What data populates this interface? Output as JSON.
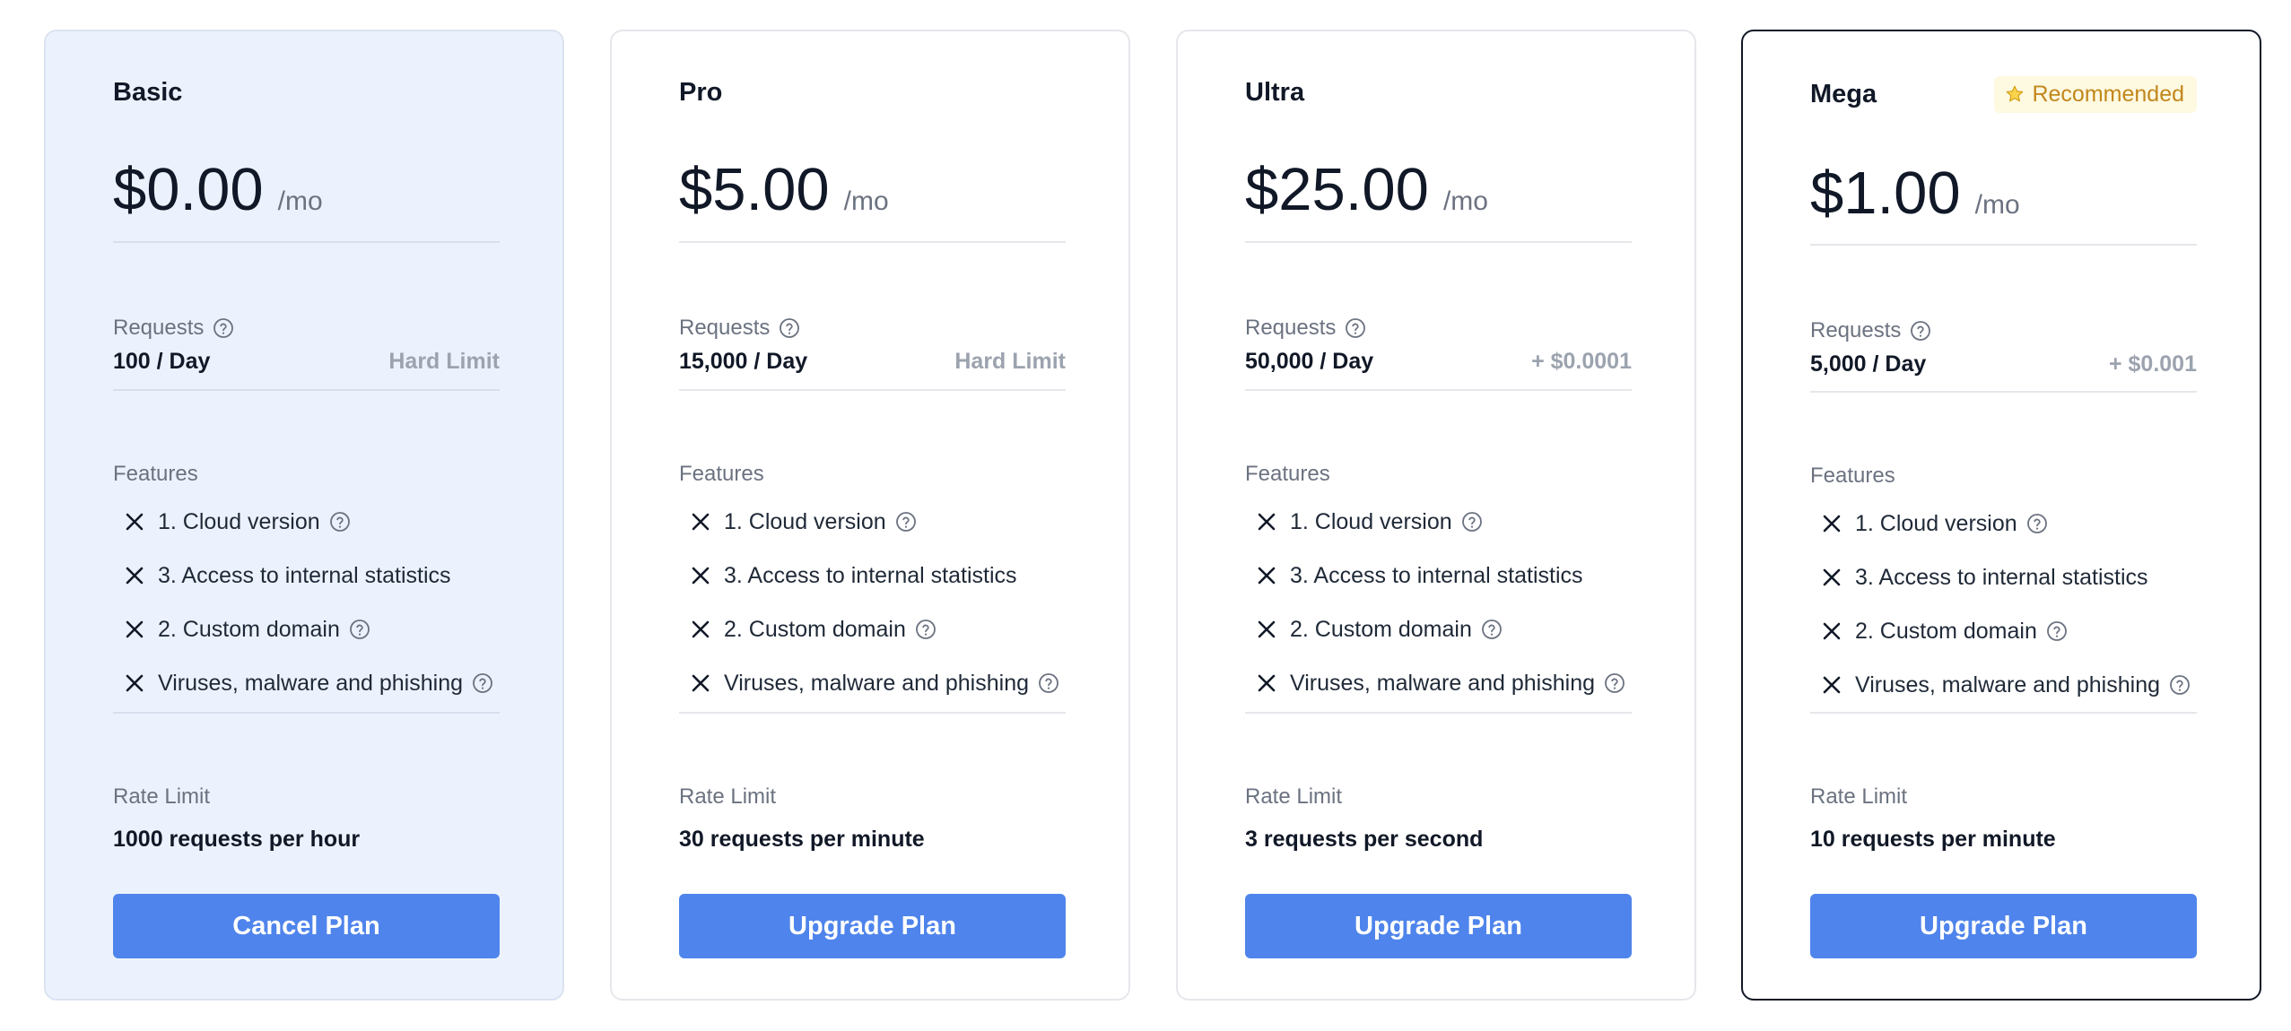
{
  "plans": [
    {
      "name": "Basic",
      "price": "$0.00",
      "period": "/mo",
      "requests_label": "Requests",
      "requests_value": "100 / Day",
      "requests_extra": "Hard Limit",
      "features_label": "Features",
      "features": [
        {
          "text": "1. Cloud version",
          "help": true
        },
        {
          "text": "3. Access to internal statistics",
          "help": false
        },
        {
          "text": "2. Custom domain",
          "help": true
        },
        {
          "text": "Viruses, malware and phishing",
          "help": true
        }
      ],
      "rate_limit_label": "Rate Limit",
      "rate_limit_value": "1000 requests per hour",
      "button": "Cancel Plan"
    },
    {
      "name": "Pro",
      "price": "$5.00",
      "period": "/mo",
      "requests_label": "Requests",
      "requests_value": "15,000 / Day",
      "requests_extra": "Hard Limit",
      "features_label": "Features",
      "features": [
        {
          "text": "1. Cloud version",
          "help": true
        },
        {
          "text": "3. Access to internal statistics",
          "help": false
        },
        {
          "text": "2. Custom domain",
          "help": true
        },
        {
          "text": "Viruses, malware and phishing",
          "help": true
        }
      ],
      "rate_limit_label": "Rate Limit",
      "rate_limit_value": "30 requests per minute",
      "button": "Upgrade Plan"
    },
    {
      "name": "Ultra",
      "price": "$25.00",
      "period": "/mo",
      "requests_label": "Requests",
      "requests_value": "50,000 / Day",
      "requests_extra": "+ $0.0001",
      "features_label": "Features",
      "features": [
        {
          "text": "1. Cloud version",
          "help": true
        },
        {
          "text": "3. Access to internal statistics",
          "help": false
        },
        {
          "text": "2. Custom domain",
          "help": true
        },
        {
          "text": "Viruses, malware and phishing",
          "help": true
        }
      ],
      "rate_limit_label": "Rate Limit",
      "rate_limit_value": "3 requests per second",
      "button": "Upgrade Plan"
    },
    {
      "name": "Mega",
      "badge": "Recommended",
      "price": "$1.00",
      "period": "/mo",
      "requests_label": "Requests",
      "requests_value": "5,000 / Day",
      "requests_extra": "+ $0.001",
      "features_label": "Features",
      "features": [
        {
          "text": "1. Cloud version",
          "help": true
        },
        {
          "text": "3. Access to internal statistics",
          "help": false
        },
        {
          "text": "2. Custom domain",
          "help": true
        },
        {
          "text": "Viruses, malware and phishing",
          "help": true
        }
      ],
      "rate_limit_label": "Rate Limit",
      "rate_limit_value": "10 requests per minute",
      "button": "Upgrade Plan"
    }
  ],
  "colors": {
    "accent": "#4f84ec",
    "current_plan_bg": "#ecf2fd",
    "badge_bg": "#fef9e1",
    "badge_text": "#c2871c",
    "muted_text": "#6b7280"
  },
  "icons": {
    "excluded_feature": "x-icon",
    "help": "help-circle-icon",
    "badge": "star-icon"
  }
}
